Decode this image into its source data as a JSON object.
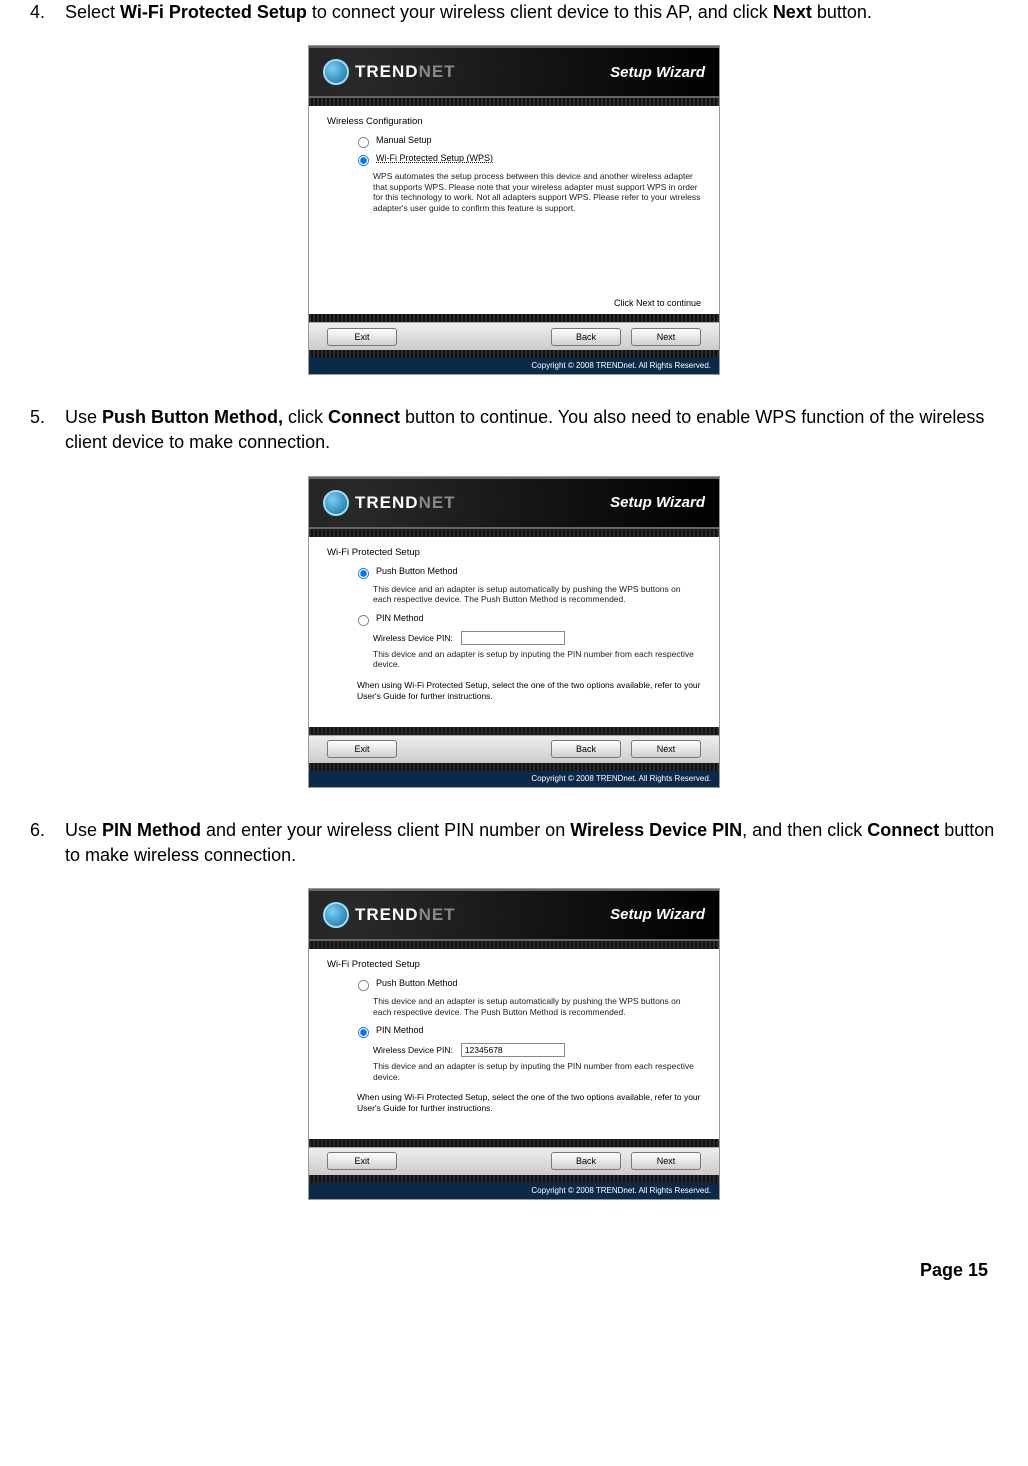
{
  "step4": {
    "num": "4.",
    "pre": "Select ",
    "bold1": "Wi-Fi Protected Setup",
    "mid": " to connect your wireless client device to this AP, and click ",
    "bold2": "Next",
    "post": " button."
  },
  "step5": {
    "num": "5.",
    "pre": "Use ",
    "bold1": "Push Button Method,",
    "mid": " click ",
    "bold2": "Connect",
    "post": " button to continue. You also need to enable WPS function of the wireless client device to make connection."
  },
  "step6": {
    "num": "6.",
    "pre": "Use ",
    "bold1": "PIN Method",
    "mid": " and enter your wireless client PIN number on ",
    "bold2": "Wireless Device PIN",
    "mid2": ", and then click ",
    "bold3": "Connect",
    "post": " button to make wireless connection."
  },
  "wizard": {
    "brand1": "TREND",
    "brand2": "NET",
    "title": "Setup Wizard",
    "hint": "Click Next to continue",
    "btn_exit": "Exit",
    "btn_back": "Back",
    "btn_next": "Next",
    "copyright": "Copyright © 2008 TRENDnet. All Rights Reserved."
  },
  "shot1": {
    "heading": "Wireless Configuration",
    "opt1": "Manual Setup",
    "opt2": "Wi-Fi Protected Setup (WPS)",
    "desc": "WPS automates the setup process between this device and another wireless adapter that supports WPS. Please note that your wireless adapter must support WPS in order for this technology to work. Not all adapters support WPS. Please refer to your wireless adapter's user guide to confirm this feature is support."
  },
  "shot2": {
    "heading": "Wi-Fi Protected Setup",
    "opt1": "Push Button Method",
    "desc1": "This device and an adapter is setup automatically by pushing the WPS buttons on each respective device. The Push Button Method is recommended.",
    "opt2": "PIN Method",
    "pin_label": "Wireless Device PIN:",
    "pin_value": "",
    "desc2": "This device and an adapter is setup by inputing the PIN number from each respective device.",
    "note": "When using Wi-Fi Protected Setup, select the one of the two options available, refer to your User's Guide for further instructions."
  },
  "shot3": {
    "heading": "Wi-Fi Protected Setup",
    "opt1": "Push Button Method",
    "desc1": "This device and an adapter is setup automatically by pushing the WPS buttons on each respective device. The Push Button Method is recommended.",
    "opt2": "PIN Method",
    "pin_label": "Wireless Device PIN:",
    "pin_value": "12345678",
    "desc2": "This device and an adapter is setup by inputing the PIN number from each respective device.",
    "note": "When using Wi-Fi Protected Setup, select the one of the two options available, refer to your User's Guide for further instructions."
  },
  "page": {
    "footer": "Page 15"
  }
}
